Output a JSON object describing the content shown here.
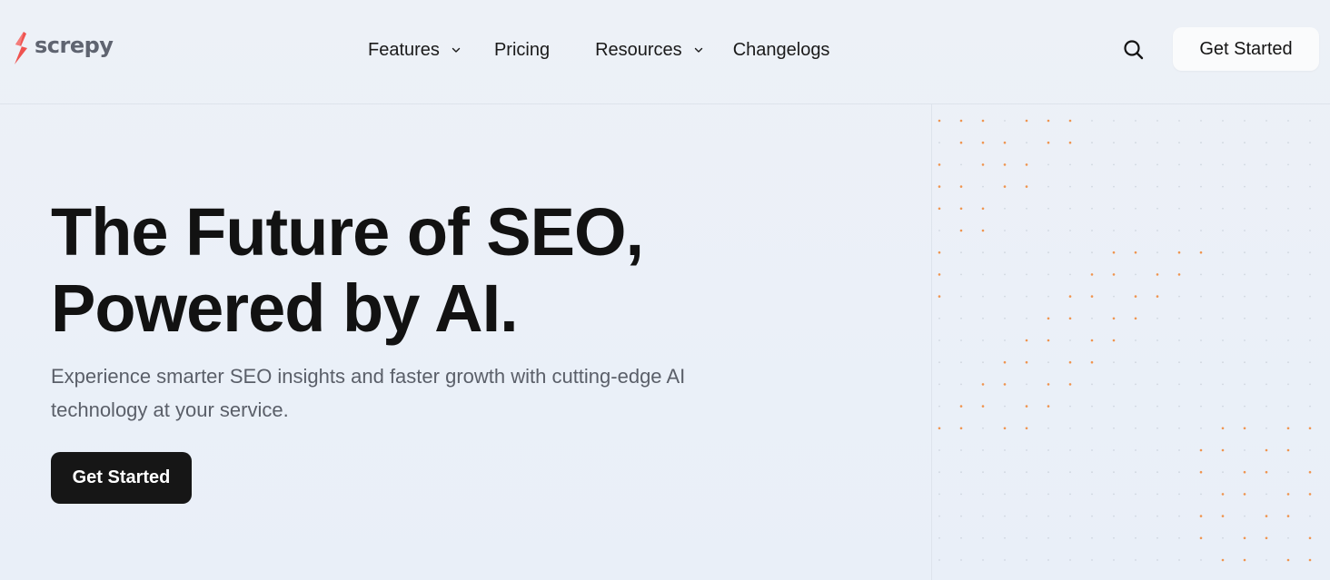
{
  "brand": {
    "name": "screpy",
    "accent_color": "#ef5350",
    "logo_icon": "bolt-s-icon"
  },
  "nav": {
    "items": [
      {
        "label": "Features",
        "has_dropdown": true
      },
      {
        "label": "Pricing",
        "has_dropdown": false
      },
      {
        "label": "Resources",
        "has_dropdown": true
      },
      {
        "label": "Changelogs",
        "has_dropdown": false
      }
    ],
    "search_icon": "search-icon",
    "cta_label": "Get Started"
  },
  "hero": {
    "title_line1": "The Future of SEO,",
    "title_line2": "Powered by AI.",
    "subtitle": "Experience smarter SEO insights and faster growth with cutting-edge AI technology at your service.",
    "cta_label": "Get Started"
  },
  "colors": {
    "background": "#ebf0f7",
    "text": "#141414",
    "muted_text": "#5a5f69",
    "dark_button": "#161616",
    "dot_orange": "#f08a3c",
    "dot_gray": "#c5ccd6"
  }
}
